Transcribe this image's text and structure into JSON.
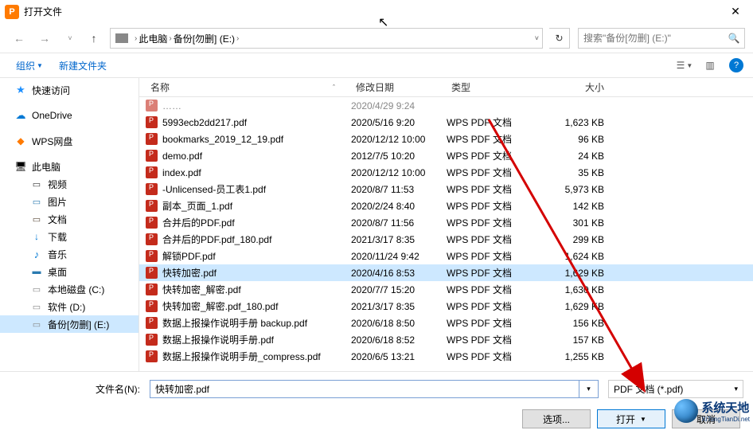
{
  "title": "打开文件",
  "breadcrumb": {
    "pc": "此电脑",
    "drive": "备份[勿删] (E:)"
  },
  "search_placeholder": "搜索\"备份[勿删] (E:)\"",
  "toolbar": {
    "organize": "组织",
    "newfolder": "新建文件夹"
  },
  "sidebar": {
    "quick": "快速访问",
    "onedrive": "OneDrive",
    "wps": "WPS网盘",
    "pc": "此电脑",
    "video": "视频",
    "pic": "图片",
    "doc": "文档",
    "dl": "下载",
    "music": "音乐",
    "desk": "桌面",
    "drv_c": "本地磁盘 (C:)",
    "drv_d": "软件 (D:)",
    "drv_e": "备份[勿删] (E:)"
  },
  "columns": {
    "name": "名称",
    "date": "修改日期",
    "type": "类型",
    "size": "大小"
  },
  "files": [
    {
      "name": "5993ecb2dd217.pdf",
      "date": "2020/5/16 9:20",
      "type": "WPS PDF 文档",
      "size": "1,623 KB"
    },
    {
      "name": "bookmarks_2019_12_19.pdf",
      "date": "2020/12/12 10:00",
      "type": "WPS PDF 文档",
      "size": "96 KB"
    },
    {
      "name": "demo.pdf",
      "date": "2012/7/5 10:20",
      "type": "WPS PDF 文档",
      "size": "24 KB"
    },
    {
      "name": "index.pdf",
      "date": "2020/12/12 10:00",
      "type": "WPS PDF 文档",
      "size": "35 KB"
    },
    {
      "name": "-Unlicensed-员工表1.pdf",
      "date": "2020/8/7 11:53",
      "type": "WPS PDF 文档",
      "size": "5,973 KB"
    },
    {
      "name": "副本_页面_1.pdf",
      "date": "2020/2/24 8:40",
      "type": "WPS PDF 文档",
      "size": "142 KB"
    },
    {
      "name": "合并后的PDF.pdf",
      "date": "2020/8/7 11:56",
      "type": "WPS PDF 文档",
      "size": "301 KB"
    },
    {
      "name": "合并后的PDF.pdf_180.pdf",
      "date": "2021/3/17 8:35",
      "type": "WPS PDF 文档",
      "size": "299 KB"
    },
    {
      "name": "解锁PDF.pdf",
      "date": "2020/11/24 9:42",
      "type": "WPS PDF 文档",
      "size": "1,624 KB"
    },
    {
      "name": "快转加密.pdf",
      "date": "2020/4/16 8:53",
      "type": "WPS PDF 文档",
      "size": "1,629 KB",
      "selected": true
    },
    {
      "name": "快转加密_解密.pdf",
      "date": "2020/7/7 15:20",
      "type": "WPS PDF 文档",
      "size": "1,630 KB"
    },
    {
      "name": "快转加密_解密.pdf_180.pdf",
      "date": "2021/3/17 8:35",
      "type": "WPS PDF 文档",
      "size": "1,629 KB"
    },
    {
      "name": "数据上报操作说明手册 backup.pdf",
      "date": "2020/6/18 8:50",
      "type": "WPS PDF 文档",
      "size": "156 KB"
    },
    {
      "name": "数据上报操作说明手册.pdf",
      "date": "2020/6/18 8:52",
      "type": "WPS PDF 文档",
      "size": "157 KB"
    },
    {
      "name": "数据上报操作说明手册_compress.pdf",
      "date": "2020/6/5 13:21",
      "type": "WPS PDF 文档",
      "size": "1,255 KB"
    }
  ],
  "cutrow_date": "2020/4/29 9:24",
  "filename_label": "文件名(N):",
  "filename_value": "快转加密.pdf",
  "filter_label": "PDF 文档 (*.pdf)",
  "buttons": {
    "options": "选项...",
    "open": "打开",
    "cancel": "取消"
  },
  "watermark": {
    "main": "系统天地",
    "sub": "XiTongTianDi.net"
  }
}
